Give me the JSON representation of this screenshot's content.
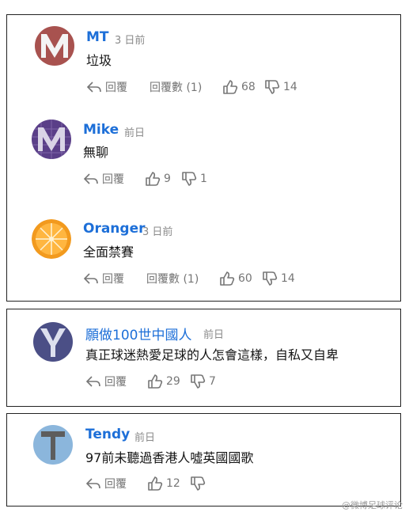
{
  "comments": [
    {
      "name": "MT",
      "time": "3 日前",
      "text": "垃圾",
      "reply": "回覆",
      "reply_count": "回覆數 (1)",
      "likes": "68",
      "dislikes": "14"
    },
    {
      "name": "Mike",
      "time": "前日",
      "text": "無聊",
      "reply": "回覆",
      "likes": "9",
      "dislikes": "1"
    },
    {
      "name": "Oranger",
      "time": "3 日前",
      "text": "全面禁賽",
      "reply": "回覆",
      "reply_count": "回覆數 (1)",
      "likes": "60",
      "dislikes": "14"
    },
    {
      "name": "願做100世中國人",
      "time": "前日",
      "text": "真正球迷熱愛足球的人怎會這樣，自私又自卑",
      "reply": "回覆",
      "likes": "29",
      "dislikes": "7"
    },
    {
      "name": "Tendy",
      "time": "前日",
      "text": "97前未聽過香港人噓英國國歌",
      "reply": "回覆",
      "likes": "12",
      "dislikes": ""
    }
  ],
  "avatars": [
    {
      "letter": "M",
      "bg": "#a8524f",
      "fg": "#f4f4f4"
    },
    {
      "letter": "M",
      "bg": "#5a3f88",
      "fg": "#d9d4e6"
    },
    {
      "letter": "",
      "bg": "#f29a1e",
      "fg": "#ffd27a"
    },
    {
      "letter": "Y",
      "bg": "#4b4f86",
      "fg": "#dde0ee"
    },
    {
      "letter": "T",
      "bg": "#8bb6dc",
      "fg": "#5d5d5d"
    }
  ],
  "icons": {
    "reply": "reply-arrow-icon",
    "like": "thumbs-up-icon",
    "dislike": "thumbs-down-icon"
  },
  "colors": {
    "name": "#1d6fd8",
    "meta": "#8a8a8a",
    "action": "#767676"
  },
  "watermark": "@微博足球评论"
}
